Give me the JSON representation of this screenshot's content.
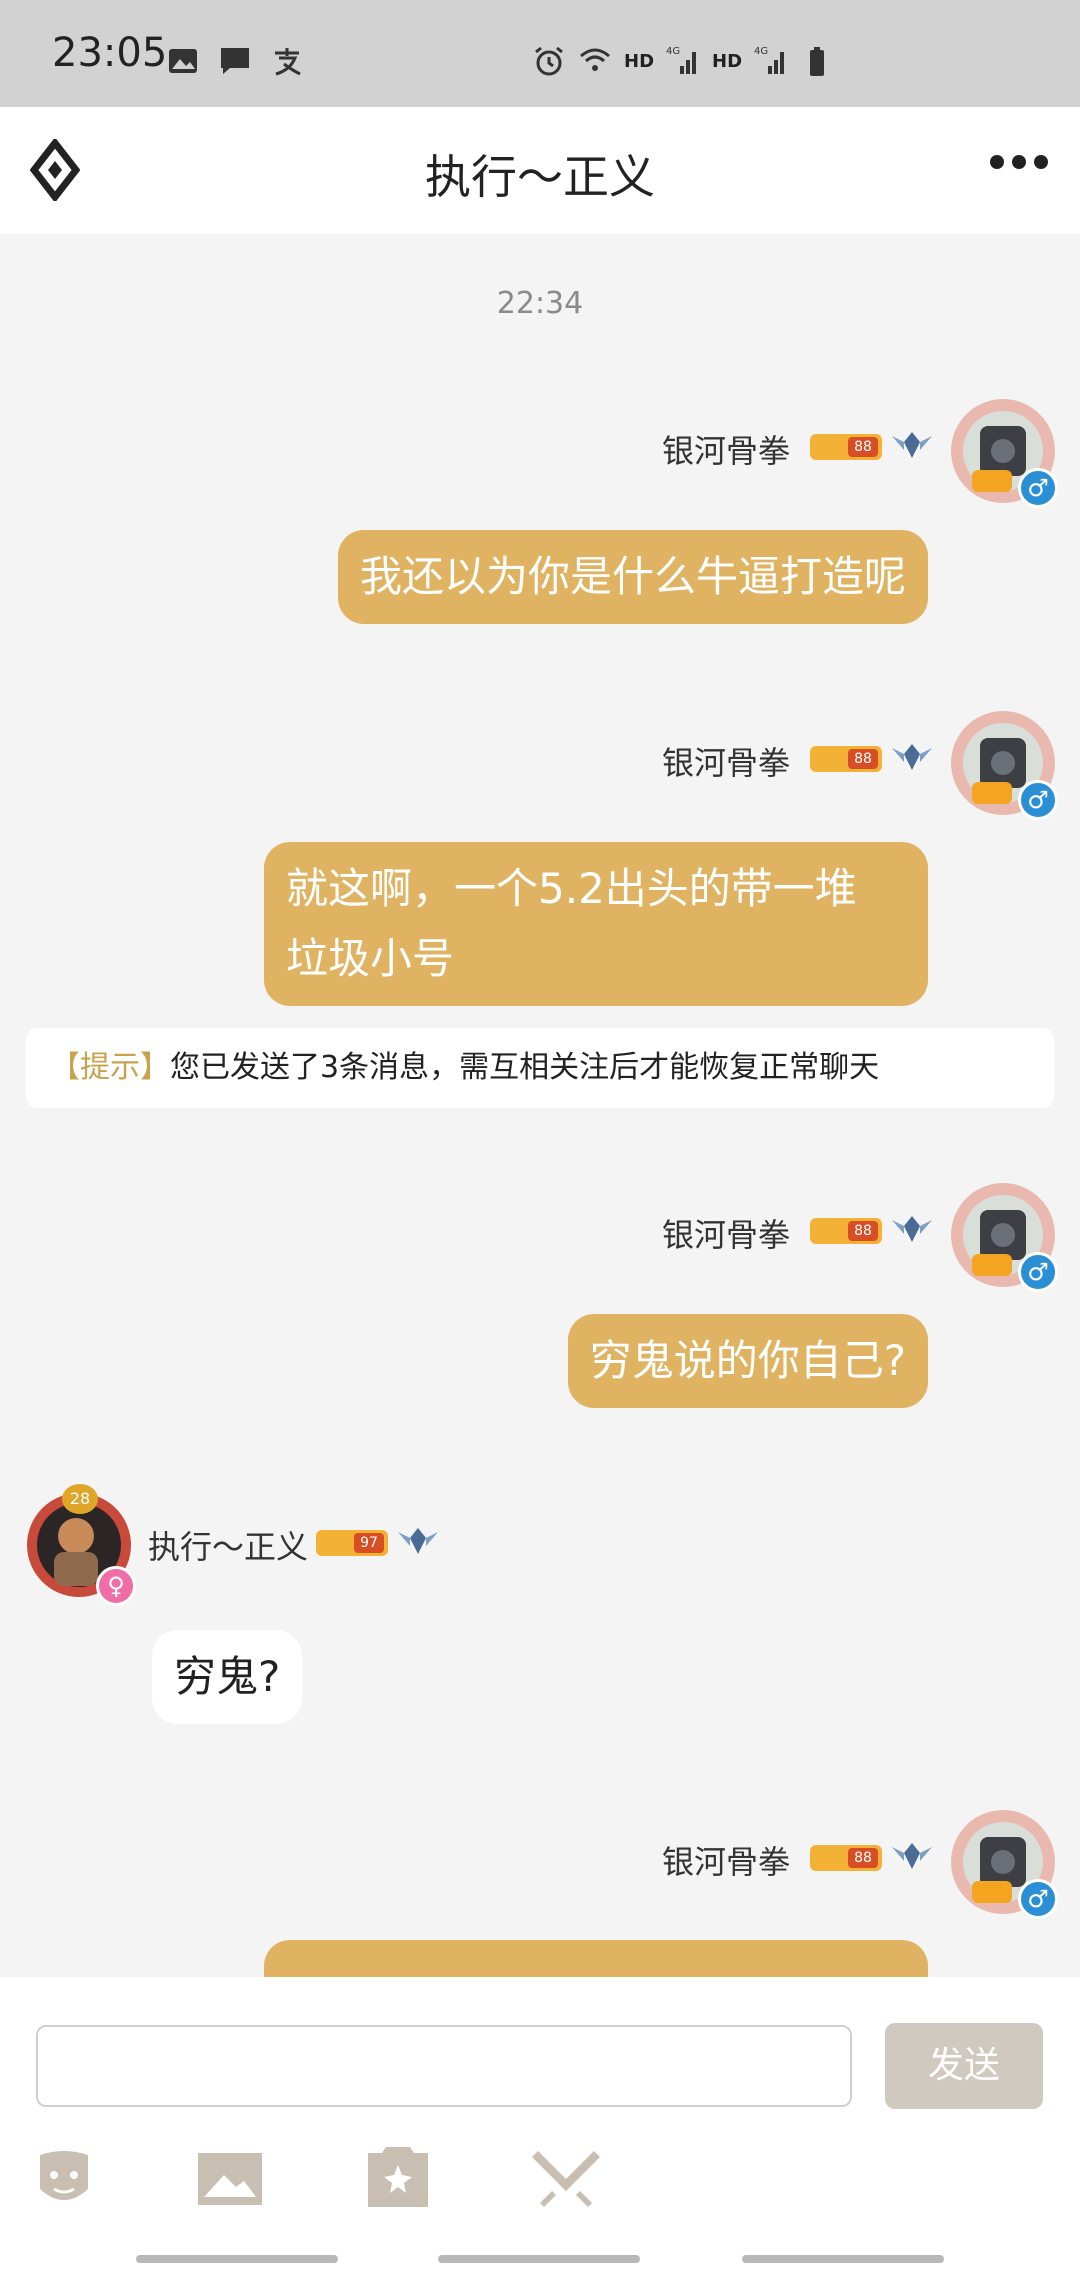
{
  "status_bar": {
    "time": "23:05",
    "hd1": "HD",
    "net1": "4G",
    "hd2": "HD",
    "net2": "4G"
  },
  "header": {
    "title": "执行～正义"
  },
  "chat": {
    "timestamp": "22:34",
    "messages": [
      {
        "sender": "银河骨拳",
        "level": "88",
        "text": "我还以为你是什么牛逼打造呢"
      },
      {
        "sender": "银河骨拳",
        "level": "88",
        "line1": "就这啊，一个5.2出头的带一堆",
        "line2": "垃圾小号"
      },
      {
        "sender": "银河骨拳",
        "level": "88",
        "text": "穷鬼说的你自己?"
      },
      {
        "sender": "执行～正义",
        "level": "97",
        "avatar_level": "28",
        "text": "穷鬼?"
      },
      {
        "sender": "银河骨拳",
        "level": "88",
        "text": ""
      }
    ],
    "tip": {
      "tag": "【提示】",
      "text": "您已发送了3条消息，需互相关注后才能恢复正常聊天"
    }
  },
  "input": {
    "placeholder": "",
    "send_label": "发送"
  },
  "colors": {
    "bubble_self": "#dfb362",
    "tip_tag": "#c9a24e",
    "send_button": "#cfc9c0"
  },
  "icons": [
    "image-icon",
    "message-icon",
    "alipay-icon",
    "alarm-icon",
    "wifi-icon",
    "signal-icon",
    "battery-icon",
    "game-logo-icon",
    "more-icon",
    "emoji-icon",
    "photo-icon",
    "sticker-icon",
    "battle-icon"
  ]
}
